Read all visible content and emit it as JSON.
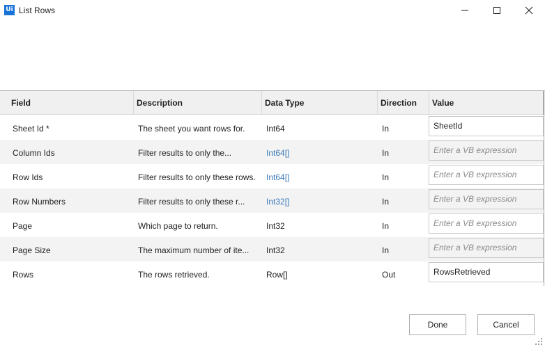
{
  "window": {
    "app_logo": "Ui",
    "title": "List Rows",
    "controls": [
      "minimize-icon",
      "maximize-icon",
      "close-icon"
    ]
  },
  "grid": {
    "headers": {
      "field": "Field",
      "description": "Description",
      "data_type": "Data Type",
      "direction": "Direction",
      "value": "Value"
    },
    "rows": [
      {
        "field": "Sheet Id *",
        "description": "The sheet you want rows for.",
        "data_type": "Int64",
        "type_link": false,
        "direction": "In",
        "value": "SheetId",
        "placeholder": ""
      },
      {
        "field": "Column Ids",
        "description": "Filter results to only the...",
        "data_type": "Int64[]",
        "type_link": true,
        "direction": "In",
        "value": "",
        "placeholder": "Enter a VB expression"
      },
      {
        "field": "Row Ids",
        "description": "Filter results to only these rows.",
        "data_type": "Int64[]",
        "type_link": true,
        "direction": "In",
        "value": "",
        "placeholder": "Enter a VB expression"
      },
      {
        "field": "Row Numbers",
        "description": "Filter results to only these r...",
        "data_type": "Int32[]",
        "type_link": true,
        "direction": "In",
        "value": "",
        "placeholder": "Enter a VB expression"
      },
      {
        "field": "Page",
        "description": "Which page to return.",
        "data_type": "Int32",
        "type_link": false,
        "direction": "In",
        "value": "",
        "placeholder": "Enter a VB expression"
      },
      {
        "field": "Page Size",
        "description": "The maximum number of ite...",
        "data_type": "Int32",
        "type_link": false,
        "direction": "In",
        "value": "",
        "placeholder": "Enter a VB expression"
      },
      {
        "field": "Rows",
        "description": "The rows retrieved.",
        "data_type": "Row[]",
        "type_link": false,
        "direction": "Out",
        "value": "RowsRetrieved",
        "placeholder": ""
      }
    ]
  },
  "footer": {
    "done_label": "Done",
    "cancel_label": "Cancel"
  },
  "colors": {
    "logo": "#1a73d9",
    "type_link": "#3d7ab8",
    "header_bg": "#f0f0f0",
    "alt_row_bg": "#f3f3f3"
  }
}
